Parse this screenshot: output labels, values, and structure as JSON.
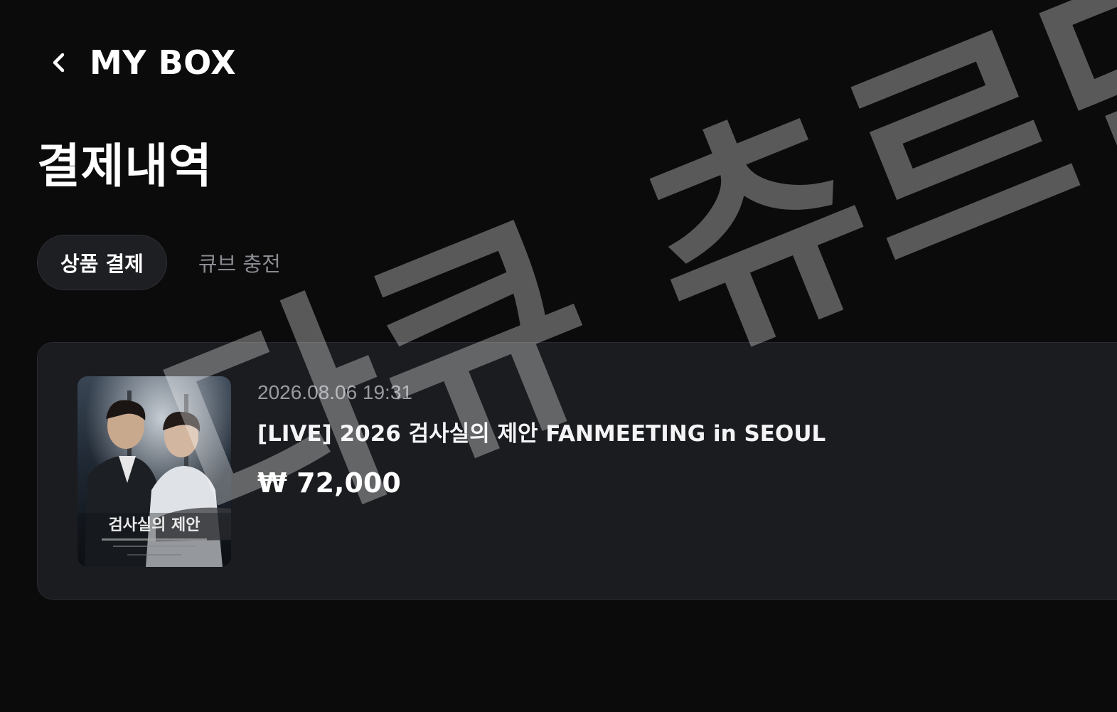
{
  "header": {
    "back_icon": "chevron-left-icon",
    "title": "MY BOX"
  },
  "page": {
    "title": "결제내역"
  },
  "tabs": [
    {
      "label": "상품 결제",
      "active": true
    },
    {
      "label": "큐브 충전",
      "active": false
    }
  ],
  "payments": [
    {
      "date": "2026.08.06 19:31",
      "product": "[LIVE] 2026 검사실의 제안 FANMEETING in SEOUL",
      "price": "₩ 72,000",
      "thumbnail": {
        "icon": "poster-image",
        "poster_title": "검사실의 제안"
      }
    }
  ],
  "watermark": {
    "text": "다큐 츄르단"
  },
  "colors": {
    "background": "#0b0b0c",
    "card": "#1b1c20",
    "tab_active_bg": "#1e1f23",
    "text_primary": "#ffffff",
    "text_secondary": "#9a9ba1"
  }
}
